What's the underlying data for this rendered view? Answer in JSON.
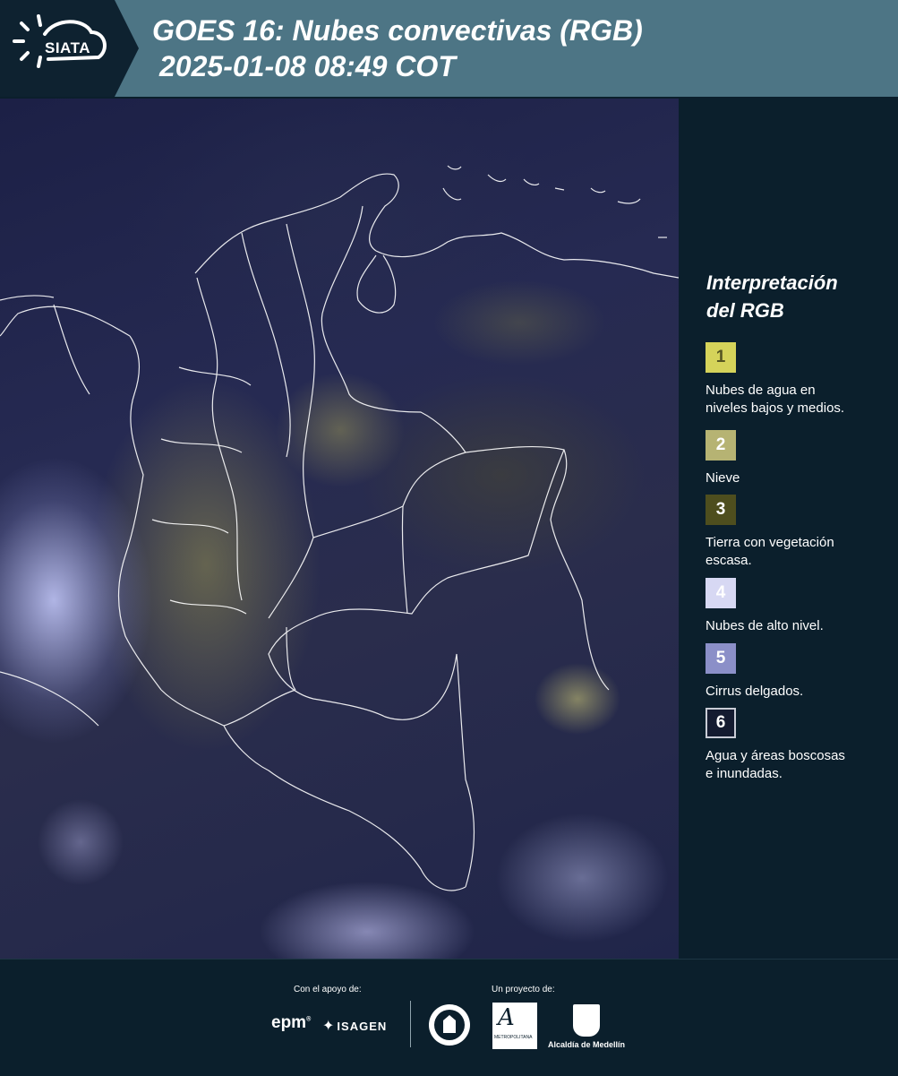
{
  "header": {
    "logo_text": "SIATA",
    "title_line1": "GOES 16: Nubes convectivas (RGB)",
    "title_line2": "2025-01-08 08:49 COT"
  },
  "legend": {
    "title_line1": "Interpretación",
    "title_line2": "del RGB",
    "items": [
      {
        "number": "1",
        "label_line1": "Nubes de agua en",
        "label_line2": "niveles bajos y medios.",
        "color": "#d5d35a",
        "text_color": "#555522",
        "border": "#d5d35a"
      },
      {
        "number": "2",
        "label_line1": "Nieve",
        "label_line2": "",
        "color": "#b6b373",
        "text_color": "#ffffff",
        "border": "#b6b373"
      },
      {
        "number": "3",
        "label_line1": "Tierra con vegetación",
        "label_line2": "escasa.",
        "color": "#4e4e1e",
        "text_color": "#ffffff",
        "border": "#4e4e1e"
      },
      {
        "number": "4",
        "label_line1": "Nubes de alto nivel.",
        "label_line2": "",
        "color": "#d7d8f3",
        "text_color": "#ffffff",
        "border": "#d7d8f3"
      },
      {
        "number": "5",
        "label_line1": "Cirrus delgados.",
        "label_line2": "",
        "color": "#8b8fc8",
        "text_color": "#ffffff",
        "border": "#8b8fc8"
      },
      {
        "number": "6",
        "label_line1": "Agua y áreas boscosas",
        "label_line2": "e inundadas.",
        "color": "#141b30",
        "text_color": "#ffffff",
        "border": "#c9ccd6"
      }
    ]
  },
  "footer": {
    "support_label": "Con el apoyo de:",
    "project_label": "Un proyecto de:",
    "epm": "epm",
    "isagen": "ISAGEN",
    "area_text": "METROPOLITANA",
    "alcaldia": "Alcaldía de Medellín"
  },
  "colors": {
    "header_bg": "#4d7585",
    "panel_bg": "#0b1f2c"
  }
}
